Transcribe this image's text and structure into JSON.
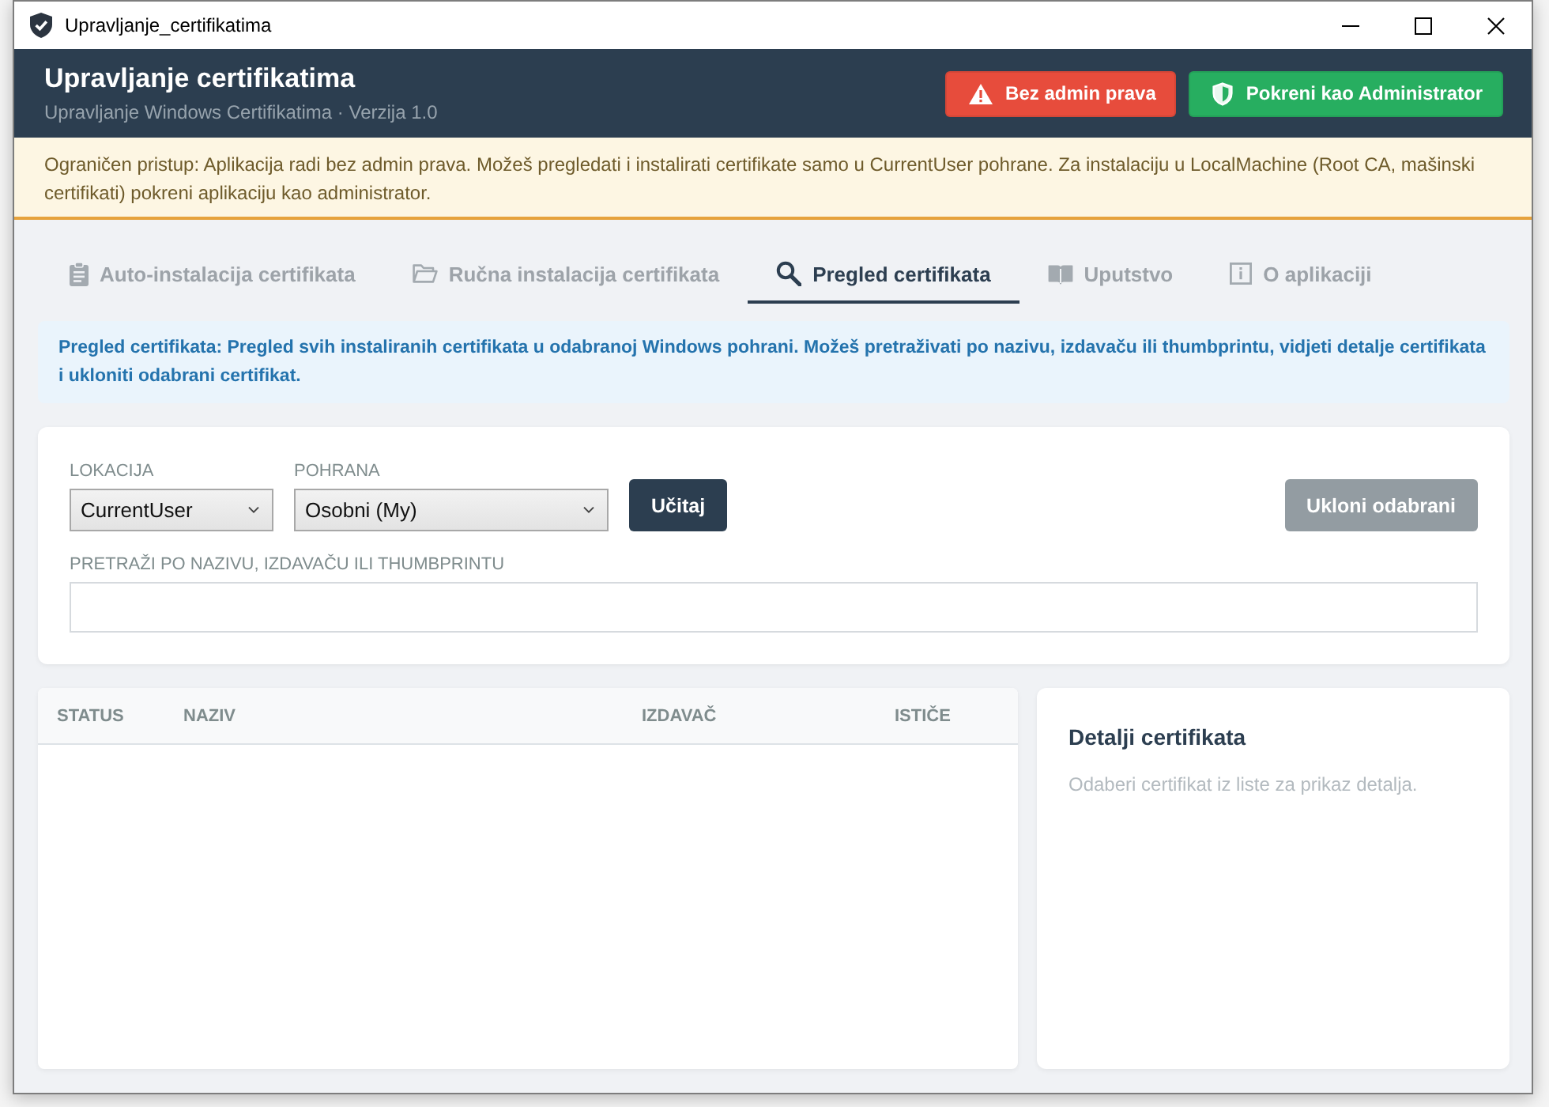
{
  "window": {
    "title": "Upravljanje_certifikatima"
  },
  "header": {
    "title": "Upravljanje certifikatima",
    "subtitle": "Upravljanje Windows Certifikatima · Verzija 1.0",
    "buttons": [
      {
        "kind": "danger",
        "label": "Bez admin prava"
      },
      {
        "kind": "success",
        "label": "Pokreni kao Administrator"
      }
    ]
  },
  "notice": {
    "text": "Ograničen pristup: Aplikacija radi bez admin prava. Možeš pregledati i instalirati certifikate samo u CurrentUser pohrane. Za instalaciju u LocalMachine (Root CA, mašinski certifikati) pokreni aplikaciju kao administrator."
  },
  "tabs": [
    {
      "label": "Auto-instalacija certifikata",
      "selected": false
    },
    {
      "label": "Ručna instalacija certifikata",
      "selected": false
    },
    {
      "label": "Pregled certifikata",
      "selected": true
    },
    {
      "label": "Uputstvo",
      "selected": false
    },
    {
      "label": "O aplikaciji",
      "selected": false
    }
  ],
  "info": {
    "text": "Pregled certifikata: Pregled svih instaliranih certifikata u odabranoj Windows pohrani. Možeš pretraživati po nazivu, izdavaču ili thumbprintu, vidjeti detalje certifikata i ukloniti odabrani certifikat."
  },
  "filters": {
    "location": {
      "label": "LOKACIJA",
      "value": "CurrentUser"
    },
    "store": {
      "label": "POHRANA",
      "value": "Osobni (My)"
    },
    "load_button": {
      "label": "Učitaj"
    },
    "remove_button": {
      "label": "Ukloni odabrani",
      "disabled": true
    },
    "search": {
      "label": "PRETRAŽI PO NAZIVU, IZDAVAČU ILI THUMBPRINTU"
    }
  },
  "table": {
    "columns": [
      "STATUS",
      "NAZIV",
      "IZDAVAČ",
      "ISTIČE"
    ]
  },
  "details": {
    "title": "Detalji certifikata",
    "message": "Odaberi certifikat iz liste za prikaz detalja."
  }
}
